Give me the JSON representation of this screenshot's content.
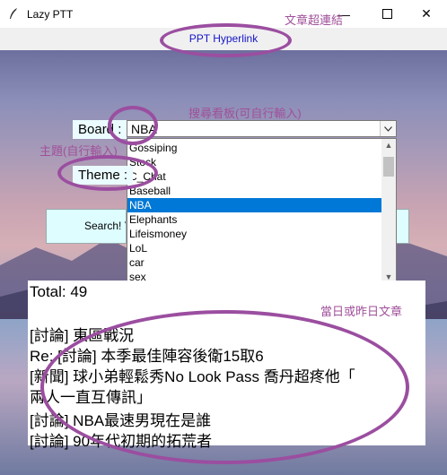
{
  "window": {
    "title": "Lazy PTT",
    "minimize_glyph": "—",
    "close_glyph": "✕"
  },
  "hyperlink": {
    "label": "PPT Hyperlink"
  },
  "board": {
    "label": "Board :",
    "value": "NBA",
    "options": [
      "Gossiping",
      "Stock",
      "C_Chat",
      "Baseball",
      "NBA",
      "Elephants",
      "Lifeismoney",
      "LoL",
      "car",
      "sex"
    ],
    "selected": "NBA"
  },
  "theme": {
    "label": "Theme :"
  },
  "search": {
    "label": "Search! Y"
  },
  "results": {
    "total": "Total: 49",
    "posts": [
      "[討論] 東區戰況",
      "Re: [討論] 本季最佳陣容後衛15取6",
      "[新聞] 球小弟輕鬆秀No Look Pass 喬丹超疼他「",
      "兩人一直互傳訊」",
      "[討論] NBA最速男現在是誰",
      "[討論] 90年代初期的拓荒者"
    ]
  },
  "annotations": {
    "hyperlink_note": "文章超連結",
    "board_note": "搜尋看板(可自行輸入)",
    "theme_note": "主題(自行輸入)",
    "daily_note": "當日或昨日文章"
  },
  "colors": {
    "annotation": "#a0509a",
    "highlight_ring": "#9b4ea0",
    "selected_item": "#0078d7",
    "link": "#1414c8",
    "label_bg": "#eafcff"
  },
  "icons": {
    "app": "feather-icon",
    "dropdown": "chevron-down-icon"
  }
}
